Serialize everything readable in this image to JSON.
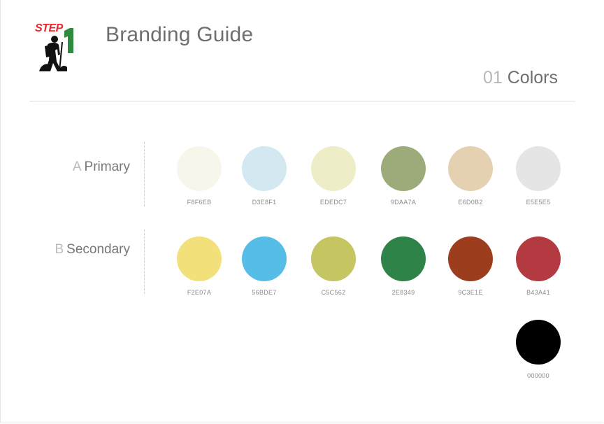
{
  "logo": {
    "word": "STEP"
  },
  "header": {
    "title": "Branding Guide",
    "section_number": "01",
    "section_title": "Colors"
  },
  "primary": {
    "letter": "A",
    "label": "Primary",
    "colors": [
      {
        "hex": "F8F6EB",
        "color": "#F8F6EB"
      },
      {
        "hex": "D3E8F1",
        "color": "#D3E8F1"
      },
      {
        "hex": "EDEDC7",
        "color": "#EDEDC7"
      },
      {
        "hex": "9DAA7A",
        "color": "#9DAA7A"
      },
      {
        "hex": "E6D0B2",
        "color": "#E6D0B2"
      },
      {
        "hex": "E5E5E5",
        "color": "#E5E5E5"
      }
    ]
  },
  "secondary": {
    "letter": "B",
    "label": "Secondary",
    "colors": [
      {
        "hex": "F2E07A",
        "color": "#F2E07A"
      },
      {
        "hex": "56BDE7",
        "color": "#56BDE7"
      },
      {
        "hex": "C5C562",
        "color": "#C5C562"
      },
      {
        "hex": "2E8349",
        "color": "#2E8349"
      },
      {
        "hex": "9C3E1E",
        "color": "#9C3E1E"
      },
      {
        "hex": "B43A41",
        "color": "#B43A41"
      }
    ]
  },
  "extra": {
    "hex": "000000",
    "color": "#000000"
  }
}
